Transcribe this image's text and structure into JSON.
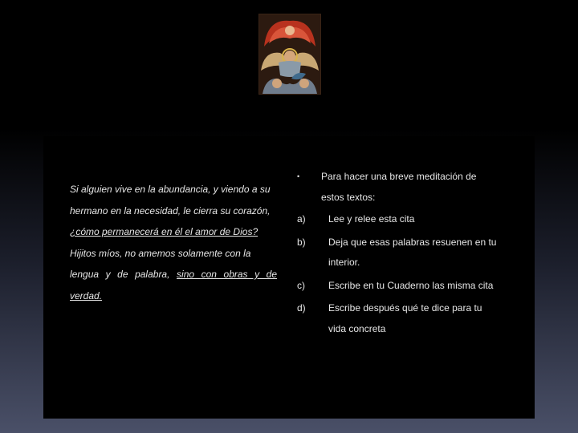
{
  "slide": {
    "left_text": {
      "line1": "Si alguien vive en la abundancia, y viendo a su",
      "line2": "hermano en la necesidad, le cierra su corazón,",
      "line3": "¿cómo permanecerá en él el amor de Dios?",
      "line4": "Hijitos míos, no amemos solamente con la",
      "line5a": "lengua y de palabra,",
      "line5b": "sino con obras y de",
      "line6": "verdad."
    },
    "instructions": {
      "bullet": "•",
      "intro_line1": "Para hacer una breve meditación de",
      "intro_line2": "estos textos:",
      "items": [
        {
          "marker": "a)",
          "line1": "Lee y relee esta cita",
          "line2": ""
        },
        {
          "marker": "b)",
          "line1": "Deja que esas palabras resuenen en tu",
          "line2": "interior."
        },
        {
          "marker": "c)",
          "line1": "Escribe en tu Cuaderno las misma cita",
          "line2": ""
        },
        {
          "marker": "d)",
          "line1": "Escribe después qué te dice para tu",
          "line2": "vida concreta"
        }
      ]
    },
    "colors": {
      "text": "#e6e6e6",
      "panel": "#000000"
    }
  }
}
